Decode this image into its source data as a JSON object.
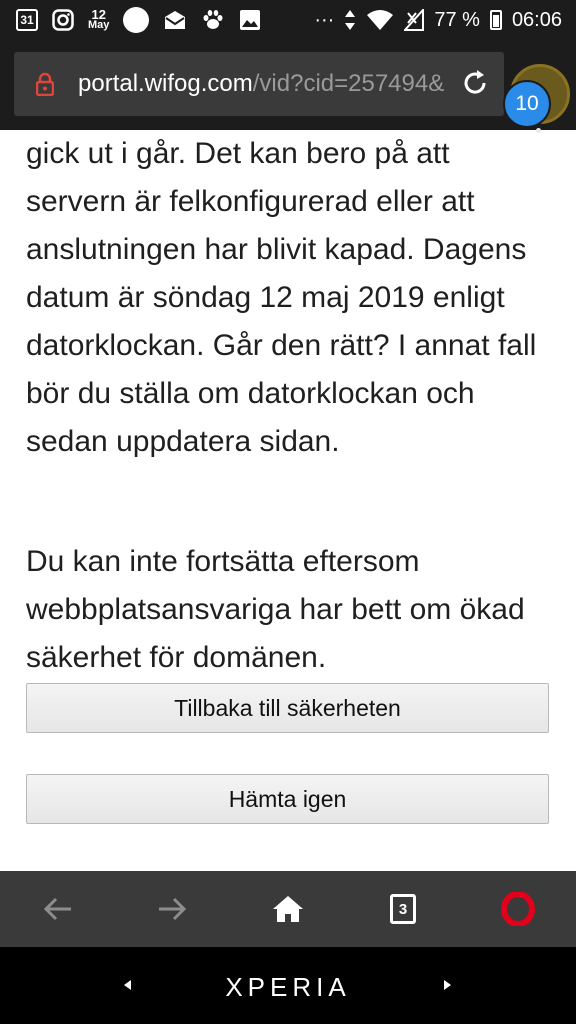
{
  "status_bar": {
    "calendar_day": "31",
    "date_day": "12",
    "date_month": "May",
    "more": "···",
    "battery": "77 %",
    "time": "06:06",
    "icons": [
      "calendar-icon",
      "instagram-icon",
      "date-icon",
      "circle-icon",
      "mail-icon",
      "paw-icon",
      "image-icon",
      "data-arrows-icon",
      "wifi-icon",
      "signal-icon",
      "battery-icon"
    ]
  },
  "address_bar": {
    "domain": "portal.wifog.com",
    "path": "/vid?cid=257494&",
    "tab_badge": "10"
  },
  "content": {
    "paragraph1": "gick ut i går. Det kan bero på att servern är felkonfigurerad eller att anslutningen har blivit kapad. Dagens datum är söndag 12 maj 2019 enligt datorklockan. Går den rätt? I annat fall bör du ställa om datorklockan och sedan uppdatera sidan.",
    "paragraph2": "Du kan inte fortsätta eftersom webbplatsansvariga har bett om ökad säkerhet för domänen.",
    "button_back": "Tillbaka till säkerheten",
    "button_retry": "Hämta igen"
  },
  "bottom_nav": {
    "tabs_count": "3"
  },
  "system_nav": {
    "brand": "XPERIA"
  },
  "colors": {
    "status_bg": "#1c1c1c",
    "url_bg": "#3a3a3a",
    "badge": "#2a8be8",
    "lock": "#e0443a",
    "opera": "#e3001b"
  }
}
